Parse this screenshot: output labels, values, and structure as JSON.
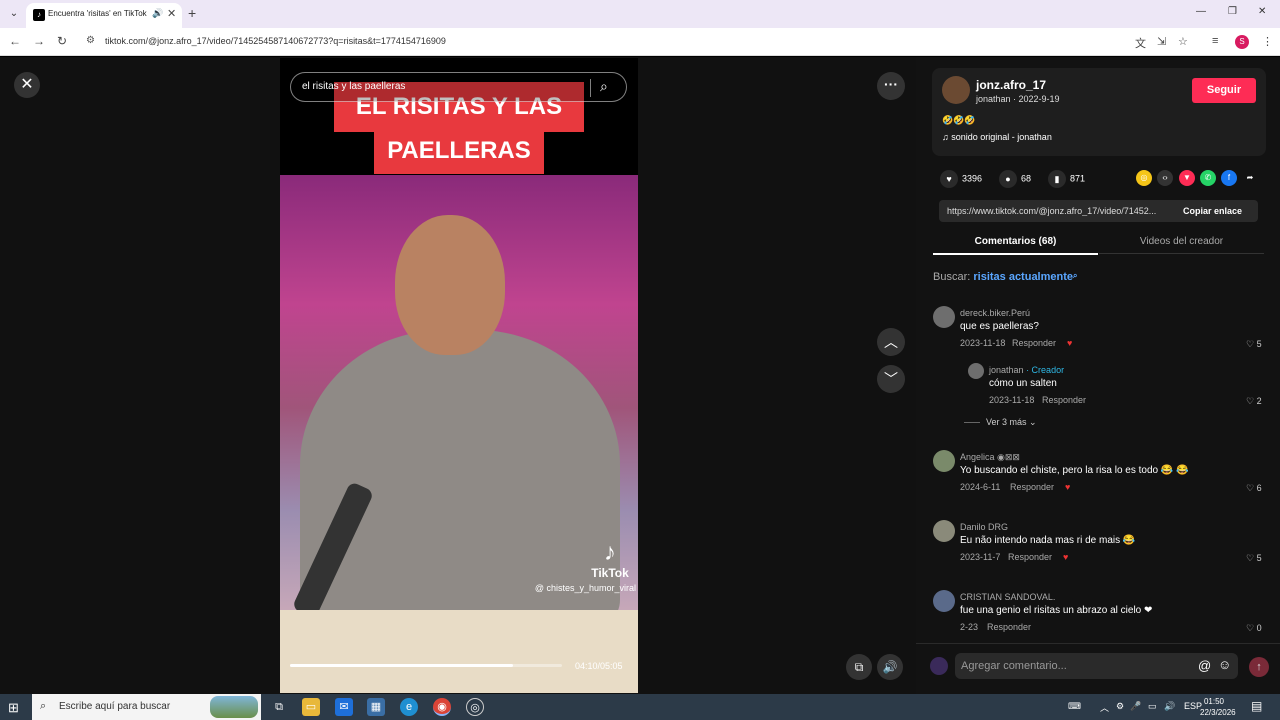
{
  "browser": {
    "tab_title": "Encuentra 'risitas' en TikTok",
    "url": "tiktok.com/@jonz.afro_17/video/7145254587140672773?q=risitas&t=1774154716909",
    "profile_initial": "S"
  },
  "video": {
    "search_text": "el risitas y las paelleras",
    "overlay_line1": "EL RISITAS Y LAS",
    "overlay_line2": "PAELLERAS",
    "watermark_brand": "TikTok",
    "watermark_handle": "@ chistes_y_humor_viral",
    "time_display": "04:10/05:05",
    "progress_fraction": 0.82
  },
  "creator": {
    "username": "jonz.afro_17",
    "display_line": "jonathan · 2022-9-19",
    "follow_label": "Seguir",
    "description": "🤣🤣🤣",
    "music": "♫  sonido original - jonathan"
  },
  "stats": {
    "likes": "3396",
    "comments": "68",
    "saves": "871"
  },
  "share": {
    "link": "https://www.tiktok.com/@jonz.afro_17/video/71452...",
    "copy_label": "Copiar enlace"
  },
  "tabs": {
    "comments": "Comentarios (68)",
    "creator_videos": "Videos del creador"
  },
  "search": {
    "prefix": "Buscar:",
    "query": "risitas actualmente"
  },
  "comments": [
    {
      "user": "dereck.biker.Perú",
      "text": "que es paelleras?",
      "date": "2023-11-18",
      "likes": "5"
    },
    {
      "user": "Angelica ◉⊠⊠",
      "text": "Yo buscando el chiste, pero la risa lo es todo 😂 😂",
      "date": "2024-6-11",
      "likes": "6"
    },
    {
      "user": "Danilo DRG",
      "text": "Eu não intendo nada mas ri de mais 😂",
      "date": "2023-11-7",
      "likes": "5"
    },
    {
      "user": "CRISTIAN SANDOVAL.",
      "text": "fue una genio el risitas un abrazo al cielo ❤",
      "date": "2-23",
      "likes": "0"
    }
  ],
  "reply": {
    "user": "jonathan",
    "badge": "· Creador",
    "text": "cómo un salten",
    "date": "2023-11-18",
    "likes": "2"
  },
  "labels": {
    "reply": "Responder",
    "more_replies": "Ver 3 más"
  },
  "comment_input": {
    "placeholder": "Agregar comentario..."
  },
  "taskbar": {
    "search_placeholder": "Escribe aquí para buscar",
    "language": "ESP",
    "time": "01:50",
    "date": "22/3/2026"
  }
}
